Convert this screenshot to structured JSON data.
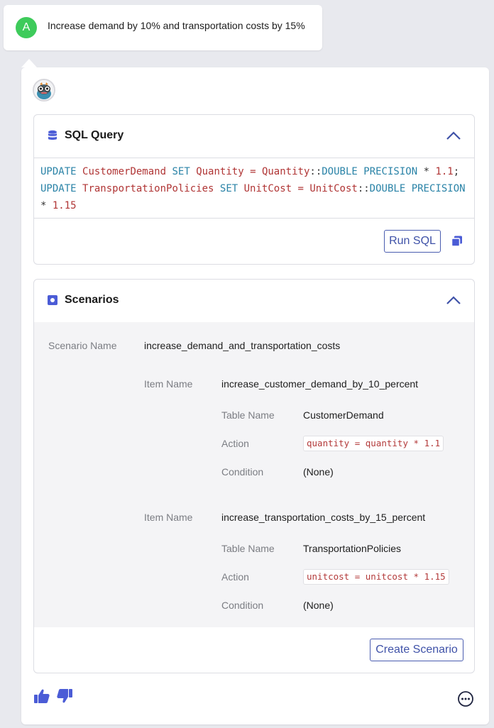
{
  "user_message": {
    "avatar_letter": "A",
    "text": "Increase demand by 10% and transportation costs by 15%"
  },
  "sql_panel": {
    "title": "SQL Query",
    "query_tokens": [
      {
        "t": "UPDATE",
        "c": "kw"
      },
      {
        "t": " "
      },
      {
        "t": "CustomerDemand",
        "c": "id"
      },
      {
        "t": " "
      },
      {
        "t": "SET",
        "c": "kw"
      },
      {
        "t": " "
      },
      {
        "t": "Quantity",
        "c": "id"
      },
      {
        "t": " "
      },
      {
        "t": "=",
        "c": "id"
      },
      {
        "t": " "
      },
      {
        "t": "Quantity",
        "c": "id"
      },
      {
        "t": "::"
      },
      {
        "t": "DOUBLE",
        "c": "kw"
      },
      {
        "t": " "
      },
      {
        "t": "PRECISION",
        "c": "kw"
      },
      {
        "t": " "
      },
      {
        "t": "*"
      },
      {
        "t": " "
      },
      {
        "t": "1.1",
        "c": "id"
      },
      {
        "t": "; "
      },
      {
        "t": "UPDATE",
        "c": "kw"
      },
      {
        "t": " "
      },
      {
        "t": "TransportationPolicies",
        "c": "id"
      },
      {
        "t": " "
      },
      {
        "t": "SET",
        "c": "kw"
      },
      {
        "t": " "
      },
      {
        "t": "UnitCost",
        "c": "id"
      },
      {
        "t": " "
      },
      {
        "t": "=",
        "c": "id"
      },
      {
        "t": " "
      },
      {
        "t": "UnitCost",
        "c": "id"
      },
      {
        "t": "::"
      },
      {
        "t": "DOUBLE",
        "c": "kw"
      },
      {
        "t": " "
      },
      {
        "t": "PRECISION",
        "c": "kw"
      },
      {
        "t": " "
      },
      {
        "t": "*"
      },
      {
        "t": " "
      },
      {
        "t": "1.15",
        "c": "id"
      }
    ],
    "run_button": "Run SQL"
  },
  "scenarios_panel": {
    "title": "Scenarios",
    "scenario_name_label": "Scenario Name",
    "scenario_name": "increase_demand_and_transportation_costs",
    "items": [
      {
        "item_name_label": "Item Name",
        "item_name": "increase_customer_demand_by_10_percent",
        "table_name_label": "Table Name",
        "table_name": "CustomerDemand",
        "action_label": "Action",
        "action": "quantity = quantity * 1.1",
        "condition_label": "Condition",
        "condition": "(None)"
      },
      {
        "item_name_label": "Item Name",
        "item_name": "increase_transportation_costs_by_15_percent",
        "table_name_label": "Table Name",
        "table_name": "TransportationPolicies",
        "action_label": "Action",
        "action": "unitcost = unitcost * 1.15",
        "condition_label": "Condition",
        "condition": "(None)"
      }
    ],
    "create_button": "Create Scenario"
  },
  "icons": {
    "sql": "database-icon",
    "scenarios": "square-dot-icon",
    "collapse": "chevron-up-icon",
    "copy": "copy-icon",
    "thumbs_up": "thumbs-up-icon",
    "thumbs_down": "thumbs-down-icon",
    "more": "more-options-icon"
  },
  "colors": {
    "accent": "#3f52a8",
    "user_avatar": "#3ecb5b",
    "sql_keyword": "#2a83a7",
    "sql_identifier": "#b03535",
    "icon_blue": "#4b5cd6"
  }
}
